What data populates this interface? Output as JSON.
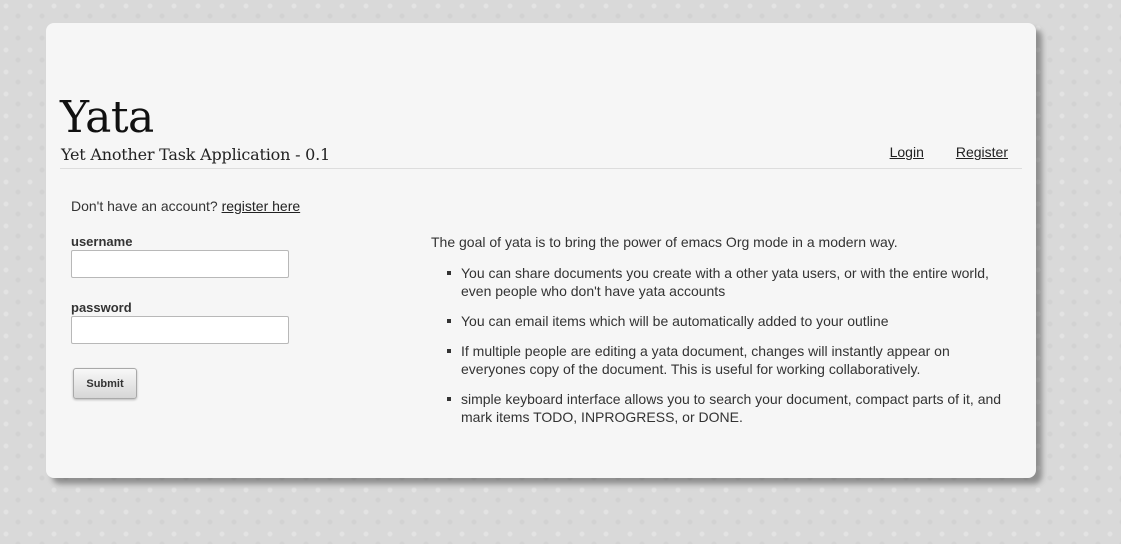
{
  "header": {
    "title": "Yata",
    "subtitle": "Yet Another Task Application - 0.1",
    "nav": {
      "login": "Login",
      "register": "Register"
    }
  },
  "signup": {
    "prompt": "Don't have an account?",
    "link": "register here"
  },
  "form": {
    "username_label": "username",
    "username_value": "",
    "password_label": "password",
    "password_value": "",
    "submit_label": "Submit"
  },
  "intro": {
    "lead": "The goal of yata is to bring the power of emacs Org mode in a modern way.",
    "features": [
      "You can share documents you create with a other yata users, or with the entire world, even people who don't have yata accounts",
      "You can email items which will be automatically added to your outline",
      "If multiple people are editing a yata document, changes will instantly appear on everyones copy of the document. This is useful for working collaboratively.",
      "simple keyboard interface allows you to search your document, compact parts of it, and mark items TODO, INPROGRESS, or DONE."
    ]
  }
}
